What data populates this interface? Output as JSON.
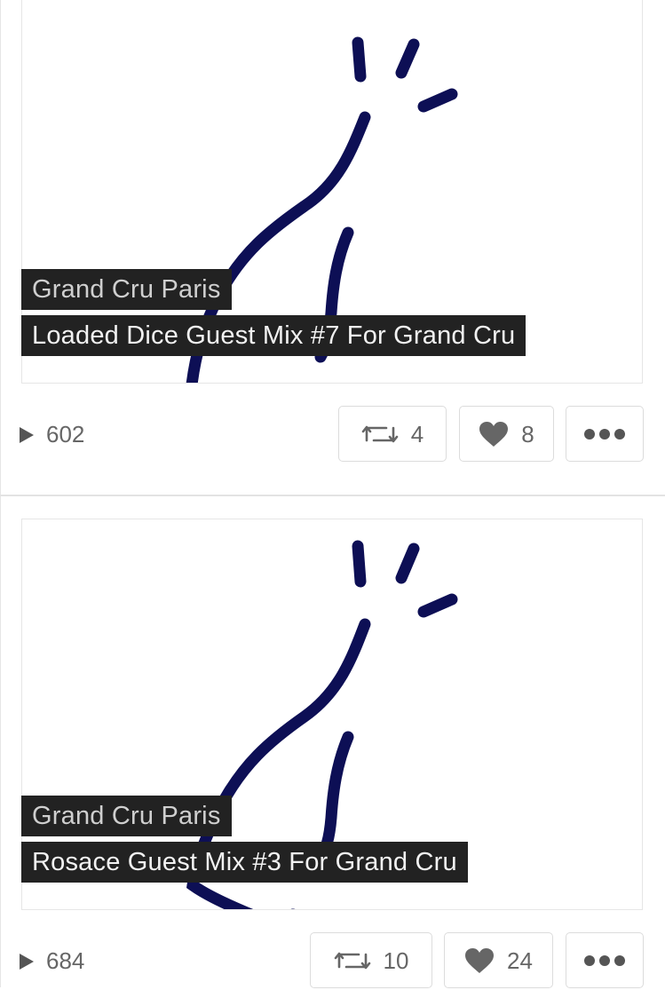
{
  "tracks": [
    {
      "user": "Grand Cru Paris",
      "title": "Loaded Dice Guest Mix #7 For Grand Cru",
      "plays": "602",
      "reposts": "4",
      "likes": "8",
      "artwork_icon": "champagne-bottle-artwork",
      "accent_color": "#0d0f55"
    },
    {
      "user": "Grand Cru Paris",
      "title": "Rosace Guest Mix #3 For Grand Cru",
      "plays": "684",
      "reposts": "10",
      "likes": "24",
      "artwork_icon": "champagne-bottle-artwork",
      "accent_color": "#0d0f55"
    }
  ],
  "icons": {
    "play": "play-icon",
    "repost": "repost-icon",
    "like": "heart-icon",
    "more": "more-icon"
  }
}
